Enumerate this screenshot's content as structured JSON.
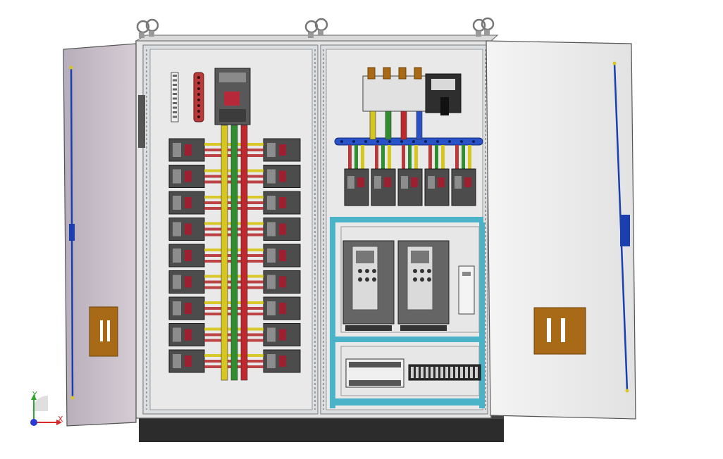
{
  "viewport": {
    "background": "#ffffff"
  },
  "triad": {
    "x_label": "X",
    "y_label": "Y",
    "x_color": "#d42a2a",
    "y_color": "#2fa52f",
    "z_color": "#2a3ad4"
  },
  "enclosure": {
    "body_color": "#e6e6e6",
    "frame_color": "#cfd3d6",
    "plinth_color": "#2c2c2c",
    "door_color_left": "#c6bcc6",
    "door_color_right": "#eeeeee",
    "handle_color": "#a86a16",
    "rod_color": "#1b3fae"
  },
  "left_panel": {
    "breaker_rows": 9,
    "busbar_colors": [
      "#d7c61f",
      "#2f8f2f",
      "#c0282d"
    ],
    "strap_color": "#b83a3a"
  },
  "right_panel": {
    "feeder_breakers": 5,
    "busbar_phase_colors": [
      "#d7c61f",
      "#2f8f2f",
      "#c0282d",
      "#2a52c8"
    ],
    "tray_color": "#4ab3c7",
    "vfd_count": 2
  }
}
